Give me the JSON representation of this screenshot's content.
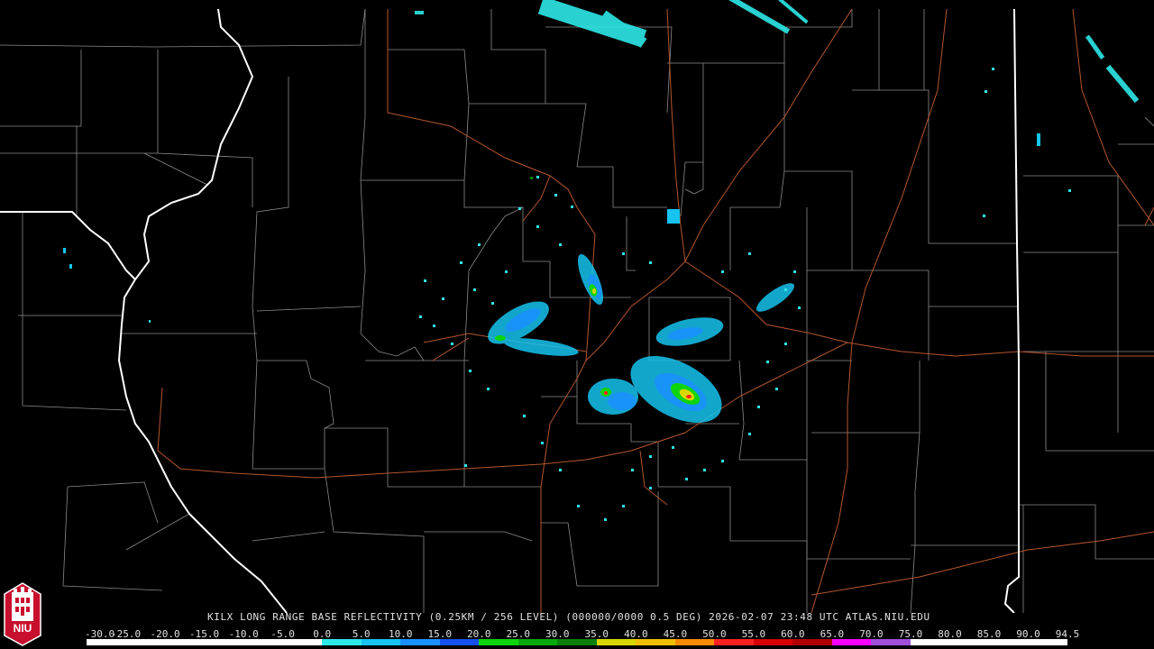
{
  "product_title": "KILX LONG RANGE BASE REFLECTIVITY (0.25KM / 256 LEVEL) (000000/0000 0.5 DEG) 2026-02-07 23:48 UTC  ATLAS.NIU.EDU",
  "logo_text": "NIU",
  "scale": {
    "labels": [
      "-30.0",
      "-25.0",
      "-20.0",
      "-15.0",
      "-10.0",
      "-5.0",
      "0.0",
      "5.0",
      "10.0",
      "15.0",
      "20.0",
      "25.0",
      "30.0",
      "35.0",
      "40.0",
      "45.0",
      "50.0",
      "55.0",
      "60.0",
      "65.0",
      "70.0",
      "75.0",
      "80.0",
      "85.0",
      "90.0",
      "94.5"
    ],
    "colors": [
      "#ffffff",
      "#ffffff",
      "#ffffff",
      "#ffffff",
      "#ffffff",
      "#ffffff",
      "#2ee8e8",
      "#16c4ef",
      "#1a90ff",
      "#1550ee",
      "#0ed40e",
      "#07a80b",
      "#0a800a",
      "#d8d800",
      "#f0c000",
      "#f88c00",
      "#ff2020",
      "#d80000",
      "#b00000",
      "#ff00ff",
      "#a050d8",
      "#ffffff",
      "#ffffff",
      "#ffffff",
      "#ffffff"
    ]
  },
  "map": {
    "background": "#000000",
    "county_line_color": "#8a8a8a",
    "state_line_color": "#ffffff",
    "highway_color": "#b4562e"
  }
}
